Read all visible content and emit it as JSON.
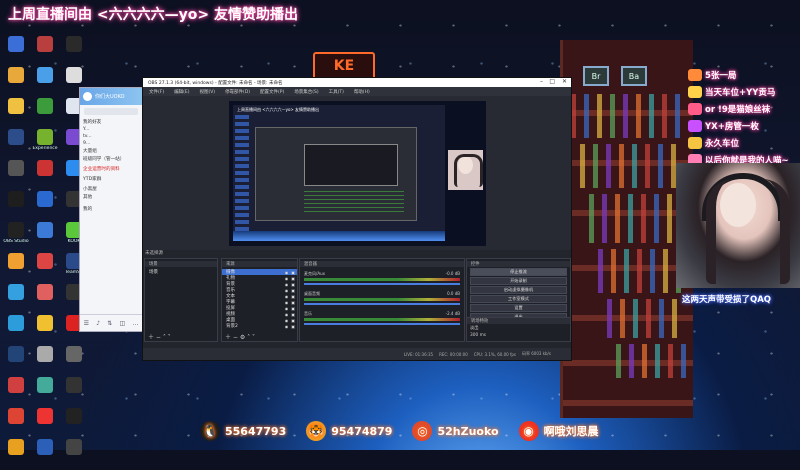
{
  "banner": "上周直播间由 <六六六六—yo> 友情赞助播出",
  "desktop_icons": [
    {
      "label": "",
      "color": "#3b6ed6"
    },
    {
      "label": "",
      "color": "#b93e3e"
    },
    {
      "label": "",
      "color": "#2a2a2a"
    },
    {
      "label": "",
      "color": "#e8a83a"
    },
    {
      "label": "",
      "color": "#4aa0e8"
    },
    {
      "label": "",
      "color": "#ddd"
    },
    {
      "label": "",
      "color": "#f0c040"
    },
    {
      "label": "",
      "color": "#3c9c3c"
    },
    {
      "label": "",
      "color": "#dfe6ef"
    },
    {
      "label": "",
      "color": "#2d4c8a"
    },
    {
      "label": "Experience",
      "color": "#77b22f"
    },
    {
      "label": "",
      "color": "#7a4ad0"
    },
    {
      "label": "",
      "color": "#555"
    },
    {
      "label": "",
      "color": "#c33"
    },
    {
      "label": "",
      "color": "#2d8cf0"
    },
    {
      "label": "",
      "color": "#1e1e1e"
    },
    {
      "label": "",
      "color": "#2a6ad0"
    },
    {
      "label": "",
      "color": "#333"
    },
    {
      "label": "OBS Studio",
      "color": "#222"
    },
    {
      "label": "",
      "color": "#3b7ad6"
    },
    {
      "label": "KOOK",
      "color": "#5ac83a"
    },
    {
      "label": "",
      "color": "#f0a030"
    },
    {
      "label": "",
      "color": "#d44"
    },
    {
      "label": "TeamSp",
      "color": "#2a4a8a"
    },
    {
      "label": "",
      "color": "#34a0e0"
    },
    {
      "label": "",
      "color": "#e06060"
    },
    {
      "label": "",
      "color": "#333"
    },
    {
      "label": "",
      "color": "#2d9cdb"
    },
    {
      "label": "",
      "color": "#f0c030"
    },
    {
      "label": "",
      "color": "#d22"
    },
    {
      "label": "",
      "color": "#224477"
    },
    {
      "label": "",
      "color": "#aaa"
    },
    {
      "label": "",
      "color": "#666"
    },
    {
      "label": "",
      "color": "#d04040"
    },
    {
      "label": "",
      "color": "#4a9"
    },
    {
      "label": "",
      "color": "#333"
    },
    {
      "label": "",
      "color": "#d43"
    },
    {
      "label": "",
      "color": "#e33"
    },
    {
      "label": "",
      "color": "#222"
    },
    {
      "label": "",
      "color": "#e8a020"
    },
    {
      "label": "",
      "color": "#2b5fb8"
    },
    {
      "label": "",
      "color": "#444"
    }
  ],
  "qq": {
    "title": "你们大UOKO",
    "groups": [
      {
        "label": "我的好友",
        "red": false
      },
      {
        "label": "Y...",
        "red": false
      },
      {
        "label": "tv...",
        "red": false
      },
      {
        "label": "9...",
        "red": false
      },
      {
        "label": "大量组",
        "red": false
      },
      {
        "label": "班级同学（管一站）",
        "red": false
      },
      {
        "label": "",
        "red": false
      },
      {
        "label": "企业运营时的资料",
        "red": true
      },
      {
        "label": "",
        "red": false
      },
      {
        "label": "YTD家群",
        "red": false
      },
      {
        "label": "",
        "red": false
      },
      {
        "label": "小黑屋",
        "red": false
      },
      {
        "label": "其他",
        "red": false
      },
      {
        "label": "",
        "red": false
      },
      {
        "label": "",
        "red": false
      },
      {
        "label": "我的",
        "red": false
      }
    ],
    "footer_icons": [
      "☰",
      "♪",
      "⇅",
      "◫",
      "…"
    ]
  },
  "obs": {
    "title": "OBS 27.1.3 (64-bit, windows) - 配置文件: 未命名 - 场景: 未命名",
    "menu": [
      "文件(F)",
      "编辑(E)",
      "视图(V)",
      "停靠部件(D)",
      "配置文件(P)",
      "场景集合(S)",
      "工具(T)",
      "帮助(H)"
    ],
    "preview_banner": "上周直播间由 <六六六六—yo> 友情赞助播出",
    "scene_collection_label": "未选择源",
    "docks": {
      "scenes": {
        "header": "场景",
        "items": [
          "场景"
        ]
      },
      "sources": {
        "header": "来源",
        "items": [
          "摄像",
          "礼物",
          "背景",
          "音乐",
          "文本",
          "字幕",
          "投屏",
          "视频",
          "桌面",
          "背景2"
        ]
      },
      "mixer": {
        "header": "混音器",
        "channels": [
          {
            "name": "麦克风/Aux",
            "db": "-0.0 dB"
          },
          {
            "name": "桌面音频",
            "db": "0.0 dB"
          },
          {
            "name": "音乐",
            "db": "-2.4 dB"
          }
        ]
      },
      "controls": {
        "header": "控件",
        "buttons": [
          "停止推流",
          "开始录制",
          "启动虚拟摄像机",
          "工作室模式",
          "设置",
          "退出"
        ]
      },
      "transitions": {
        "header": "转场特效",
        "fade": "淡出",
        "duration": "300 ms"
      }
    },
    "status": [
      "LIVE: 01:36:35",
      "REC: 00:00:00",
      "CPU: 3.1%, 60.00 fps",
      "码率 6003 kb/s"
    ]
  },
  "gifts": [
    {
      "text": "5张一局",
      "color": "#ff8a3a"
    },
    {
      "text": "当天车位+YY贡马",
      "color": "#ffd24a"
    },
    {
      "text": "or !9是猫娘丝袜",
      "color": "#ff5c8a"
    },
    {
      "text": "YX+房管一枚",
      "color": "#c850ff"
    },
    {
      "text": "永久车位",
      "color": "#f5c542"
    },
    {
      "text": "以后你就是我的人喵~",
      "color": "#ff7fb5"
    }
  ],
  "webcam_caption": "这两天声带受损了QAQ",
  "social": [
    {
      "icon": "penguin-icon",
      "text": "55647793",
      "color": "#1c1c1c",
      "glyph": "🐧"
    },
    {
      "icon": "tiger-icon",
      "text": "95474879",
      "color": "#f0a020",
      "glyph": "🐯"
    },
    {
      "icon": "bilibili-icon",
      "text": "52hZuoko",
      "color": "#e24a2a",
      "glyph": "◎"
    },
    {
      "icon": "weibo-icon",
      "text": "啊哦刘思晨",
      "color": "#e32",
      "glyph": "◉"
    }
  ],
  "pixel_sign": "KE",
  "shelf_signs": [
    "Br",
    "Ba"
  ]
}
